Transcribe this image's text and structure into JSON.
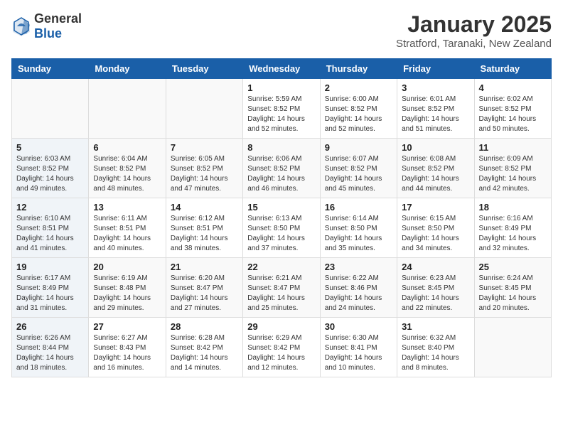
{
  "header": {
    "logo_general": "General",
    "logo_blue": "Blue",
    "month": "January 2025",
    "location": "Stratford, Taranaki, New Zealand"
  },
  "days_of_week": [
    "Sunday",
    "Monday",
    "Tuesday",
    "Wednesday",
    "Thursday",
    "Friday",
    "Saturday"
  ],
  "weeks": [
    [
      {
        "day": "",
        "sunrise": "",
        "sunset": "",
        "daylight": ""
      },
      {
        "day": "",
        "sunrise": "",
        "sunset": "",
        "daylight": ""
      },
      {
        "day": "",
        "sunrise": "",
        "sunset": "",
        "daylight": ""
      },
      {
        "day": "1",
        "sunrise": "Sunrise: 5:59 AM",
        "sunset": "Sunset: 8:52 PM",
        "daylight": "Daylight: 14 hours and 52 minutes."
      },
      {
        "day": "2",
        "sunrise": "Sunrise: 6:00 AM",
        "sunset": "Sunset: 8:52 PM",
        "daylight": "Daylight: 14 hours and 52 minutes."
      },
      {
        "day": "3",
        "sunrise": "Sunrise: 6:01 AM",
        "sunset": "Sunset: 8:52 PM",
        "daylight": "Daylight: 14 hours and 51 minutes."
      },
      {
        "day": "4",
        "sunrise": "Sunrise: 6:02 AM",
        "sunset": "Sunset: 8:52 PM",
        "daylight": "Daylight: 14 hours and 50 minutes."
      }
    ],
    [
      {
        "day": "5",
        "sunrise": "Sunrise: 6:03 AM",
        "sunset": "Sunset: 8:52 PM",
        "daylight": "Daylight: 14 hours and 49 minutes."
      },
      {
        "day": "6",
        "sunrise": "Sunrise: 6:04 AM",
        "sunset": "Sunset: 8:52 PM",
        "daylight": "Daylight: 14 hours and 48 minutes."
      },
      {
        "day": "7",
        "sunrise": "Sunrise: 6:05 AM",
        "sunset": "Sunset: 8:52 PM",
        "daylight": "Daylight: 14 hours and 47 minutes."
      },
      {
        "day": "8",
        "sunrise": "Sunrise: 6:06 AM",
        "sunset": "Sunset: 8:52 PM",
        "daylight": "Daylight: 14 hours and 46 minutes."
      },
      {
        "day": "9",
        "sunrise": "Sunrise: 6:07 AM",
        "sunset": "Sunset: 8:52 PM",
        "daylight": "Daylight: 14 hours and 45 minutes."
      },
      {
        "day": "10",
        "sunrise": "Sunrise: 6:08 AM",
        "sunset": "Sunset: 8:52 PM",
        "daylight": "Daylight: 14 hours and 44 minutes."
      },
      {
        "day": "11",
        "sunrise": "Sunrise: 6:09 AM",
        "sunset": "Sunset: 8:52 PM",
        "daylight": "Daylight: 14 hours and 42 minutes."
      }
    ],
    [
      {
        "day": "12",
        "sunrise": "Sunrise: 6:10 AM",
        "sunset": "Sunset: 8:51 PM",
        "daylight": "Daylight: 14 hours and 41 minutes."
      },
      {
        "day": "13",
        "sunrise": "Sunrise: 6:11 AM",
        "sunset": "Sunset: 8:51 PM",
        "daylight": "Daylight: 14 hours and 40 minutes."
      },
      {
        "day": "14",
        "sunrise": "Sunrise: 6:12 AM",
        "sunset": "Sunset: 8:51 PM",
        "daylight": "Daylight: 14 hours and 38 minutes."
      },
      {
        "day": "15",
        "sunrise": "Sunrise: 6:13 AM",
        "sunset": "Sunset: 8:50 PM",
        "daylight": "Daylight: 14 hours and 37 minutes."
      },
      {
        "day": "16",
        "sunrise": "Sunrise: 6:14 AM",
        "sunset": "Sunset: 8:50 PM",
        "daylight": "Daylight: 14 hours and 35 minutes."
      },
      {
        "day": "17",
        "sunrise": "Sunrise: 6:15 AM",
        "sunset": "Sunset: 8:50 PM",
        "daylight": "Daylight: 14 hours and 34 minutes."
      },
      {
        "day": "18",
        "sunrise": "Sunrise: 6:16 AM",
        "sunset": "Sunset: 8:49 PM",
        "daylight": "Daylight: 14 hours and 32 minutes."
      }
    ],
    [
      {
        "day": "19",
        "sunrise": "Sunrise: 6:17 AM",
        "sunset": "Sunset: 8:49 PM",
        "daylight": "Daylight: 14 hours and 31 minutes."
      },
      {
        "day": "20",
        "sunrise": "Sunrise: 6:19 AM",
        "sunset": "Sunset: 8:48 PM",
        "daylight": "Daylight: 14 hours and 29 minutes."
      },
      {
        "day": "21",
        "sunrise": "Sunrise: 6:20 AM",
        "sunset": "Sunset: 8:47 PM",
        "daylight": "Daylight: 14 hours and 27 minutes."
      },
      {
        "day": "22",
        "sunrise": "Sunrise: 6:21 AM",
        "sunset": "Sunset: 8:47 PM",
        "daylight": "Daylight: 14 hours and 25 minutes."
      },
      {
        "day": "23",
        "sunrise": "Sunrise: 6:22 AM",
        "sunset": "Sunset: 8:46 PM",
        "daylight": "Daylight: 14 hours and 24 minutes."
      },
      {
        "day": "24",
        "sunrise": "Sunrise: 6:23 AM",
        "sunset": "Sunset: 8:45 PM",
        "daylight": "Daylight: 14 hours and 22 minutes."
      },
      {
        "day": "25",
        "sunrise": "Sunrise: 6:24 AM",
        "sunset": "Sunset: 8:45 PM",
        "daylight": "Daylight: 14 hours and 20 minutes."
      }
    ],
    [
      {
        "day": "26",
        "sunrise": "Sunrise: 6:26 AM",
        "sunset": "Sunset: 8:44 PM",
        "daylight": "Daylight: 14 hours and 18 minutes."
      },
      {
        "day": "27",
        "sunrise": "Sunrise: 6:27 AM",
        "sunset": "Sunset: 8:43 PM",
        "daylight": "Daylight: 14 hours and 16 minutes."
      },
      {
        "day": "28",
        "sunrise": "Sunrise: 6:28 AM",
        "sunset": "Sunset: 8:42 PM",
        "daylight": "Daylight: 14 hours and 14 minutes."
      },
      {
        "day": "29",
        "sunrise": "Sunrise: 6:29 AM",
        "sunset": "Sunset: 8:42 PM",
        "daylight": "Daylight: 14 hours and 12 minutes."
      },
      {
        "day": "30",
        "sunrise": "Sunrise: 6:30 AM",
        "sunset": "Sunset: 8:41 PM",
        "daylight": "Daylight: 14 hours and 10 minutes."
      },
      {
        "day": "31",
        "sunrise": "Sunrise: 6:32 AM",
        "sunset": "Sunset: 8:40 PM",
        "daylight": "Daylight: 14 hours and 8 minutes."
      },
      {
        "day": "",
        "sunrise": "",
        "sunset": "",
        "daylight": ""
      }
    ]
  ]
}
